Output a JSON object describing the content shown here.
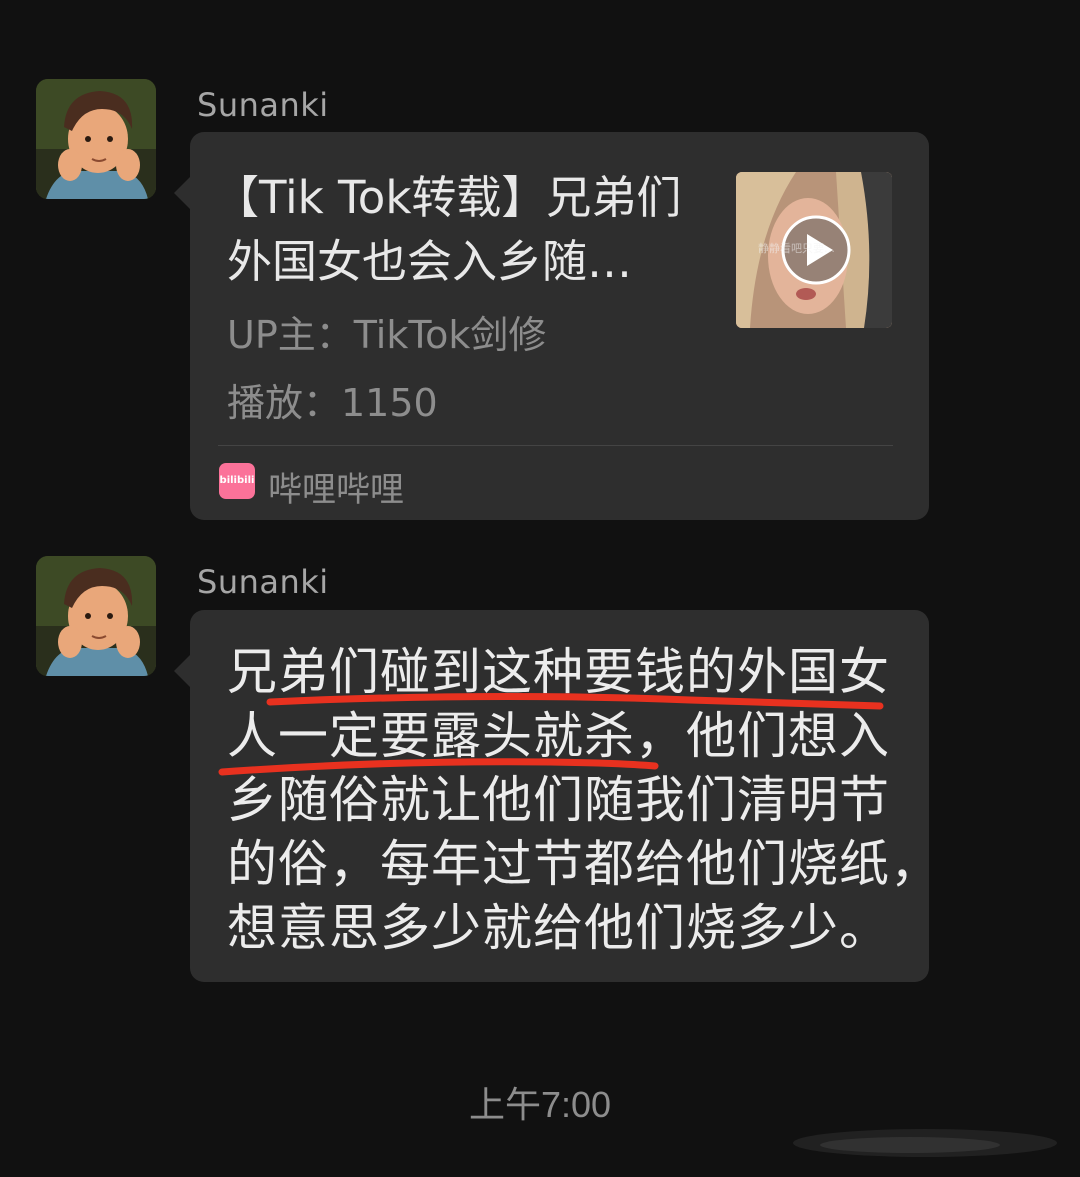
{
  "messages": [
    {
      "sender": "Sunanki",
      "type": "link-card",
      "card": {
        "title_line1": "【Tik Tok转载】兄弟们",
        "title_line2": "外国女也会入乡随…",
        "uploader": "UP主：TikTok剑修",
        "plays": "播放：1150",
        "source_icon_text": "bilibili",
        "source_name": "哔哩哔哩",
        "thumbnail_overlay_text": "静静看吧只要…",
        "thumbnail_icon": "play-icon"
      }
    },
    {
      "sender": "Sunanki",
      "type": "text",
      "lines": [
        "兄弟们碰到这种要钱的外国女",
        "人一定要露头就杀，他们想入",
        "乡随俗就让他们随我们清明节",
        "的俗，每年过节都给他们烧纸，",
        "想意思多少就给他们烧多少。"
      ],
      "annotation_color": "#e8311f"
    }
  ],
  "timestamp": "上午7:00",
  "colors": {
    "background": "#111111",
    "bubble": "#2e2e2e",
    "bilibili_pink": "#fb7299"
  }
}
